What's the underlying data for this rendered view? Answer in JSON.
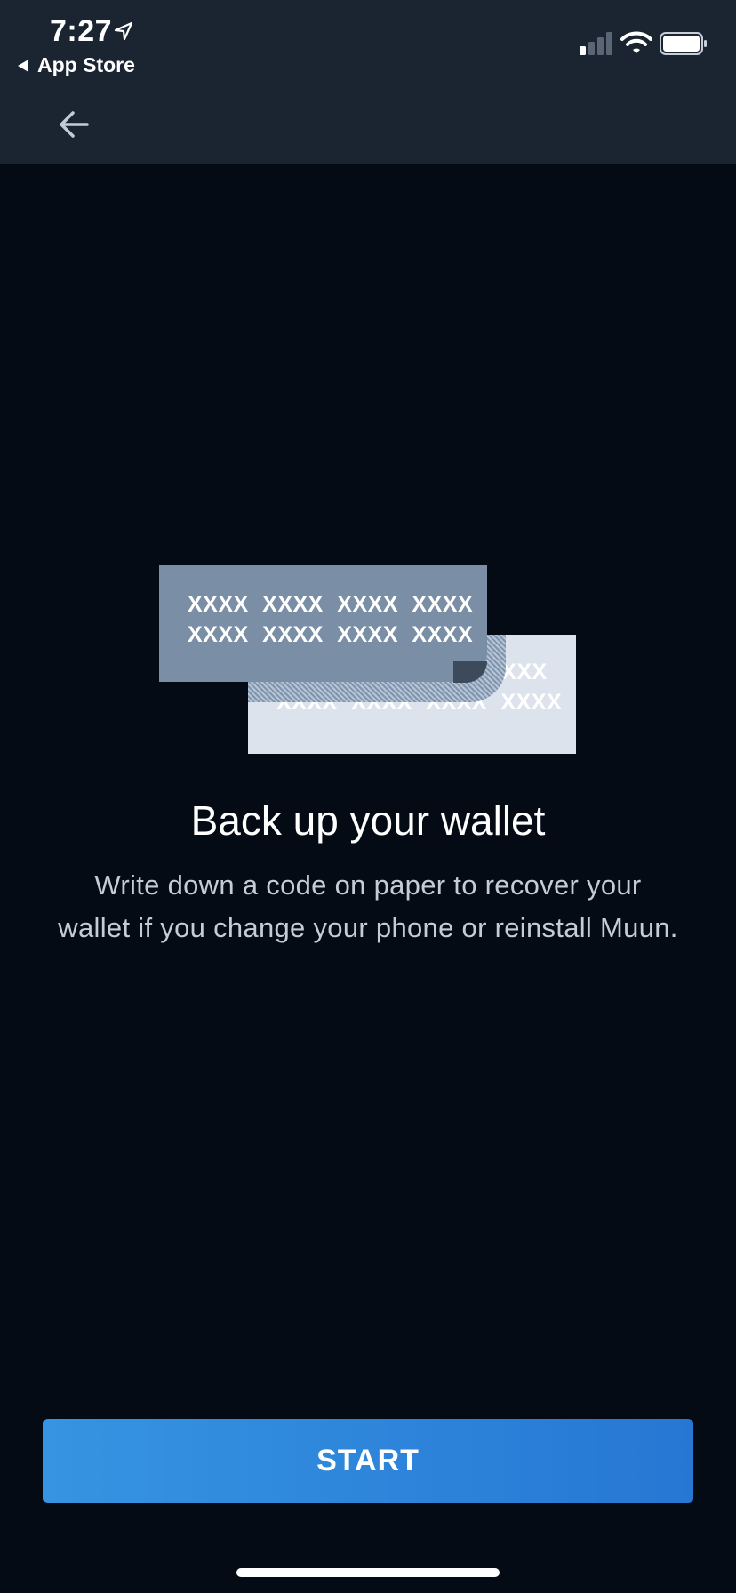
{
  "status_bar": {
    "time": "7:27",
    "back_app_label": "App Store",
    "icons": [
      "location-arrow-icon",
      "cellular-signal-icon",
      "wifi-icon",
      "battery-icon"
    ]
  },
  "nav": {
    "back_icon": "arrow-left-icon"
  },
  "illustration": {
    "front_card_rows": [
      "XXXX XXXX XXXX XXXX",
      "XXXX XXXX XXXX XXXX"
    ],
    "back_card_rows": [
      "XXXX",
      "XXXX XXXX XXXX XXXX"
    ]
  },
  "content": {
    "title": "Back up your wallet",
    "description": "Write down a code on paper to recover your wallet if you change your phone or reinstall Muun."
  },
  "actions": {
    "start_label": "START"
  },
  "colors": {
    "background": "#050b14",
    "header": "#1b2532",
    "button_start": "#3694e2",
    "button_end": "#2677d3",
    "card_front": "#7a8ea5",
    "card_back": "#dde3ec"
  }
}
